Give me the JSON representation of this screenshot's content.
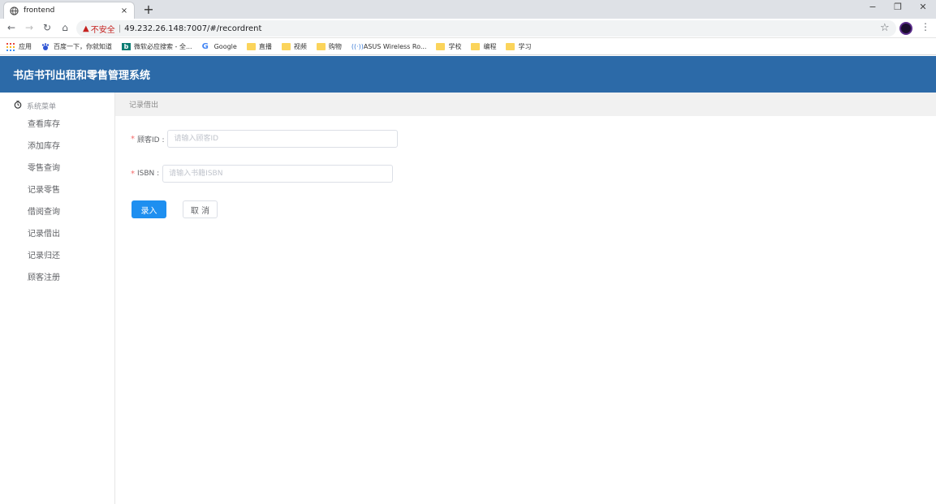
{
  "browser": {
    "tab_title": "frontend",
    "tab_close": "×",
    "new_tab": "+",
    "minimize": "−",
    "restore": "❐",
    "close": "✕",
    "security_warning": "▲",
    "security_text": "不安全",
    "separator": "|",
    "url": "49.232.26.148:7007/#/recordrent",
    "bookmarks": [
      {
        "label": "应用",
        "icon": "apps-grid-icon"
      },
      {
        "label": "百度一下，你就知道",
        "icon": "baidu-icon"
      },
      {
        "label": "微软必应搜索 - 全...",
        "icon": "bing-icon"
      },
      {
        "label": "Google",
        "icon": "google-icon"
      },
      {
        "label": "直播",
        "icon": "folder-icon"
      },
      {
        "label": "视频",
        "icon": "folder-icon"
      },
      {
        "label": "购物",
        "icon": "folder-icon"
      },
      {
        "label": "ASUS Wireless Ro...",
        "icon": "wireless-icon"
      },
      {
        "label": "学校",
        "icon": "folder-icon"
      },
      {
        "label": "编程",
        "icon": "folder-icon"
      },
      {
        "label": "学习",
        "icon": "folder-icon"
      }
    ]
  },
  "app": {
    "title": "书店书刊出租和零售管理系统"
  },
  "sidebar": {
    "header": "系统菜单",
    "items": [
      {
        "label": "查看库存"
      },
      {
        "label": "添加库存"
      },
      {
        "label": "零售查询"
      },
      {
        "label": "记录零售"
      },
      {
        "label": "借阅查询"
      },
      {
        "label": "记录借出"
      },
      {
        "label": "记录归还"
      },
      {
        "label": "顾客注册"
      }
    ]
  },
  "main": {
    "breadcrumb": "记录借出",
    "form": {
      "customer_id": {
        "required_mark": "*",
        "label": "顾客ID :",
        "value": "",
        "placeholder": "请输入顾客ID"
      },
      "isbn": {
        "required_mark": "*",
        "label": "ISBN :",
        "value": "",
        "placeholder": "请输入书籍ISBN"
      }
    },
    "buttons": {
      "submit": "录入",
      "cancel": "取 消"
    }
  },
  "colors": {
    "header_bg": "#2c6aa8",
    "primary": "#1e8ff0",
    "required": "#f56c6c"
  }
}
